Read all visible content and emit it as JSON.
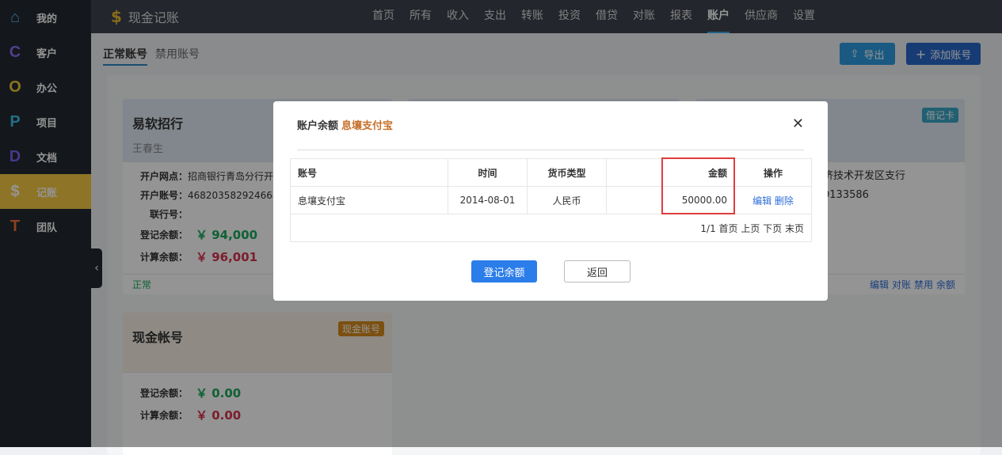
{
  "sidebar": {
    "items": [
      {
        "icon": "home-icon",
        "glyph": "⌂",
        "color": "#5ab4f0",
        "label": "我的"
      },
      {
        "icon": "letter-c-icon",
        "glyph": "C",
        "color": "#8c6cf0",
        "label": "客户"
      },
      {
        "icon": "letter-o-icon",
        "glyph": "O",
        "color": "#f0c838",
        "label": "办公"
      },
      {
        "icon": "letter-p-icon",
        "glyph": "P",
        "color": "#3cc0e8",
        "label": "项目"
      },
      {
        "icon": "letter-d-icon",
        "glyph": "D",
        "color": "#7a60f0",
        "label": "文档"
      },
      {
        "icon": "dollar-icon",
        "glyph": "$",
        "color": "#ffffff",
        "label": "记账"
      },
      {
        "icon": "letter-t-icon",
        "glyph": "T",
        "color": "#f07038",
        "label": "团队"
      }
    ]
  },
  "app": {
    "logo": "$",
    "title": "现金记账"
  },
  "nav": [
    "首页",
    "所有",
    "收入",
    "支出",
    "转账",
    "投资",
    "借贷",
    "对账",
    "报表",
    "账户",
    "供应商",
    "设置"
  ],
  "tabs": [
    "正常账号",
    "禁用账号"
  ],
  "toolbar": {
    "export": "导出",
    "add": "添加账号"
  },
  "cards": [
    {
      "title": "易软招行",
      "owner": "王春生",
      "branch_label": "开户网点：",
      "branch": "招商银行青岛分行开",
      "account_label": "开户账号：",
      "account": "4682035829246688",
      "union_label": "联行号：",
      "reg_label": "登记余额：",
      "reg": "￥ 94,000",
      "calc_label": "计算余额：",
      "calc": "￥ 96,001",
      "status": "正常"
    },
    {
      "badge": "借记卡",
      "branch_tail": "济技术开发区支行",
      "account_tail": "0133586",
      "actions": [
        "编辑",
        "对账",
        "禁用",
        "余额"
      ]
    },
    {
      "title": "现金帐号",
      "badge": "现金账号",
      "reg_label": "登记余额：",
      "reg": "￥ 0.00",
      "calc_label": "计算余额：",
      "calc": "￥ 0.00"
    }
  ],
  "modal": {
    "title": "账户余额",
    "account": "息壤支付宝",
    "columns": [
      "账号",
      "时间",
      "货币类型",
      "",
      "金额",
      "操作"
    ],
    "rows": [
      {
        "account": "息壤支付宝",
        "date": "2014-08-01",
        "currency": "人民币",
        "amount": "50000.00",
        "edit": "编辑",
        "delete": "删除"
      }
    ],
    "pager": "1/1 首页 上页 下页 末页",
    "submit": "登记余额",
    "back": "返回"
  },
  "colors": {
    "accent": "#2b7de9",
    "active_sidebar": "#f5c842"
  }
}
